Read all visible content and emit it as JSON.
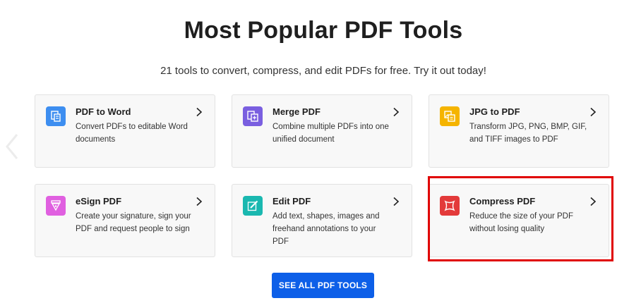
{
  "heading": "Most Popular PDF Tools",
  "subheading": "21 tools to convert, compress, and edit PDFs for free. Try it out today!",
  "cta_label": "SEE ALL PDF TOOLS",
  "colors": {
    "word": "#3d8ef0",
    "merge": "#7a5fe0",
    "jpg": "#f5b400",
    "esign": "#e060e0",
    "edit": "#1ab8b0",
    "compress": "#e33a3a",
    "cta": "#0d5fe8",
    "highlight": "#e00000"
  },
  "tools": [
    {
      "icon": "word-document-icon",
      "title": "PDF to Word",
      "desc": "Convert PDFs to editable Word documents"
    },
    {
      "icon": "merge-pages-icon",
      "title": "Merge PDF",
      "desc": "Combine multiple PDFs into one unified document"
    },
    {
      "icon": "image-convert-icon",
      "title": "JPG to PDF",
      "desc": "Transform JPG, PNG, BMP, GIF, and TIFF images to PDF"
    },
    {
      "icon": "pen-nib-icon",
      "title": "eSign PDF",
      "desc": "Create your signature, sign your PDF and request people to sign"
    },
    {
      "icon": "edit-pencil-icon",
      "title": "Edit PDF",
      "desc": "Add text, shapes, images and freehand annotations to your PDF"
    },
    {
      "icon": "compress-icon",
      "title": "Compress PDF",
      "desc": "Reduce the size of your PDF without losing quality"
    }
  ]
}
